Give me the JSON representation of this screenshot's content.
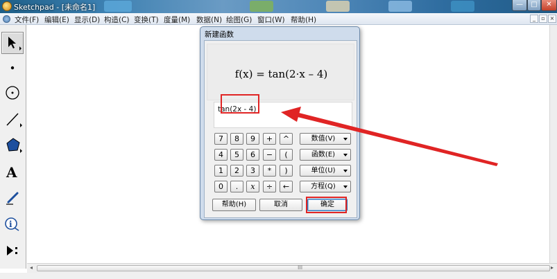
{
  "window": {
    "title": "Sketchpad - [未命名1]"
  },
  "menu": {
    "items": [
      {
        "label": "文件(F)"
      },
      {
        "label": "编辑(E)"
      },
      {
        "label": "显示(D)"
      },
      {
        "label": "构造(C)"
      },
      {
        "label": "变换(T)"
      },
      {
        "label": "度量(M)"
      },
      {
        "label": "数据(N)"
      },
      {
        "label": "绘图(G)"
      },
      {
        "label": "窗口(W)"
      },
      {
        "label": "帮助(H)"
      }
    ]
  },
  "toolbox": {
    "tools": [
      "arrow-select-icon",
      "point-icon",
      "compass-icon",
      "straightedge-icon",
      "polygon-icon",
      "text-icon",
      "marker-icon",
      "information-icon",
      "custom-tools-icon"
    ]
  },
  "dialog": {
    "title": "新建函数",
    "preview": "f(x) = tan(2·x – 4)",
    "expression": "tan(2x - 4)",
    "keypad": [
      [
        "7",
        "8",
        "9",
        "+",
        "^"
      ],
      [
        "4",
        "5",
        "6",
        "−",
        "("
      ],
      [
        "1",
        "2",
        "3",
        "*",
        ")"
      ],
      [
        "0",
        ".",
        "x",
        "÷",
        "←"
      ]
    ],
    "dropdowns": [
      "数值(V)",
      "函数(E)",
      "单位(U)",
      "方程(Q)"
    ],
    "buttons": {
      "help": "帮助(H)",
      "cancel": "取消",
      "ok": "确定"
    }
  },
  "scrollbar": {
    "grip": "III"
  },
  "colors": {
    "annotation": "#e02424",
    "titlebar": "#3b7fb0"
  }
}
